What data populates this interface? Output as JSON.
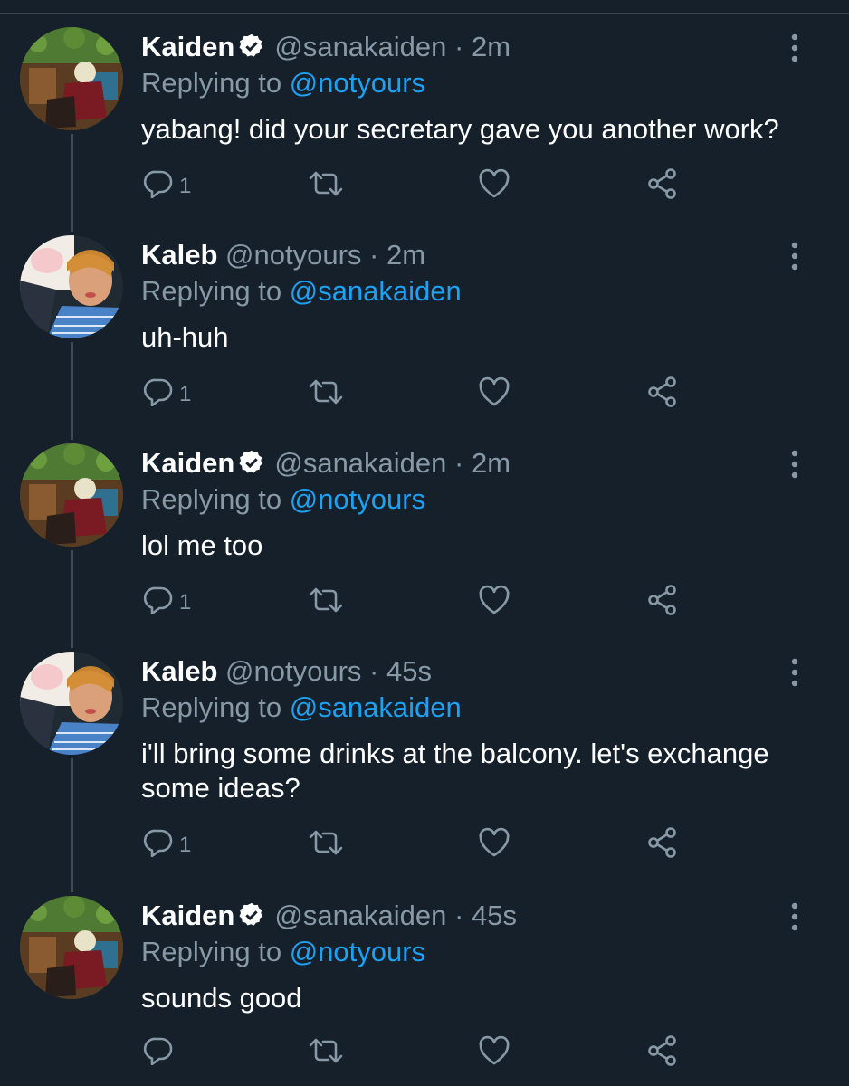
{
  "colors": {
    "background": "#15202b",
    "text_primary": "#ffffff",
    "text_secondary": "#8899a6",
    "mention": "#1da1f2",
    "thread_line": "#3d4b57",
    "icon": "#8899a6"
  },
  "replying_prefix": "Replying to",
  "tweets": [
    {
      "name": "Kaiden",
      "verified": true,
      "handle": "@sanakaiden",
      "separator": "·",
      "time": "2m",
      "replying_to": "@notyours",
      "text": "yabang! did your secretary gave you another work?",
      "reply_count": "1",
      "avatar": "kaiden-avatar",
      "icons": [
        "reply-icon",
        "retweet-icon",
        "like-icon",
        "share-icon",
        "more-icon"
      ]
    },
    {
      "name": "Kaleb",
      "verified": false,
      "handle": "@notyours",
      "separator": "·",
      "time": "2m",
      "replying_to": "@sanakaiden",
      "text": "uh-huh",
      "reply_count": "1",
      "avatar": "kaleb-avatar",
      "icons": [
        "reply-icon",
        "retweet-icon",
        "like-icon",
        "share-icon",
        "more-icon"
      ]
    },
    {
      "name": "Kaiden",
      "verified": true,
      "handle": "@sanakaiden",
      "separator": "·",
      "time": "2m",
      "replying_to": "@notyours",
      "text": "lol me too",
      "reply_count": "1",
      "avatar": "kaiden-avatar",
      "icons": [
        "reply-icon",
        "retweet-icon",
        "like-icon",
        "share-icon",
        "more-icon"
      ]
    },
    {
      "name": "Kaleb",
      "verified": false,
      "handle": "@notyours",
      "separator": "·",
      "time": "45s",
      "replying_to": "@sanakaiden",
      "text": "i'll bring some drinks at the balcony. let's exchange some ideas?",
      "reply_count": "1",
      "avatar": "kaleb-avatar",
      "icons": [
        "reply-icon",
        "retweet-icon",
        "like-icon",
        "share-icon",
        "more-icon"
      ]
    },
    {
      "name": "Kaiden",
      "verified": true,
      "handle": "@sanakaiden",
      "separator": "·",
      "time": "45s",
      "replying_to": "@notyours",
      "text": "sounds good",
      "reply_count": "",
      "avatar": "kaiden-avatar",
      "icons": [
        "reply-icon",
        "retweet-icon",
        "like-icon",
        "share-icon",
        "more-icon"
      ]
    }
  ]
}
